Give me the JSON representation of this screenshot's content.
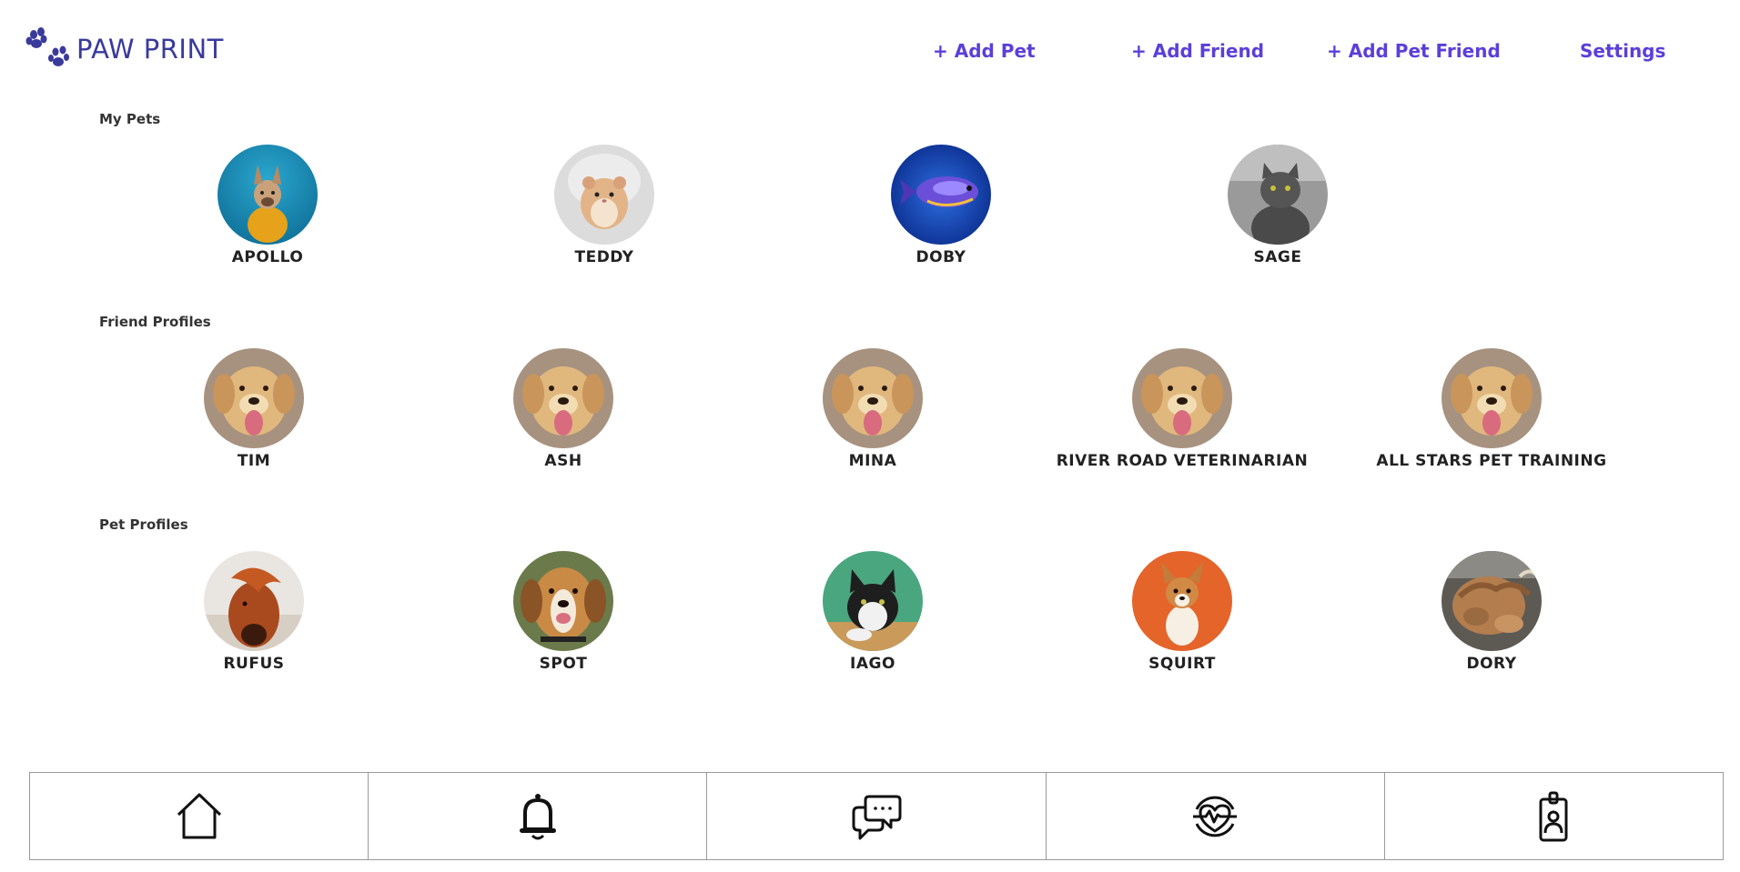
{
  "app": {
    "title": "PAW PRINT",
    "logo_icon": "paw-print-icon",
    "brand_color": "#3a3a9c",
    "accent_color": "#5b3fd9"
  },
  "nav": {
    "add_pet": "+ Add Pet",
    "add_friend": "+ Add Friend",
    "add_pet_friend": "+ Add Pet Friend",
    "settings": "Settings"
  },
  "sections": {
    "my_pets": {
      "title": "My Pets",
      "items": [
        {
          "name": "APOLLO",
          "photo": "french-bulldog-photo"
        },
        {
          "name": "TEDDY",
          "photo": "hamster-photo"
        },
        {
          "name": "DOBY",
          "photo": "fish-photo"
        },
        {
          "name": "SAGE",
          "photo": "gray-cat-photo"
        }
      ]
    },
    "friend_profiles": {
      "title": "Friend Profiles",
      "items": [
        {
          "name": "TIM",
          "photo": "golden-retriever-photo"
        },
        {
          "name": "ASH",
          "photo": "golden-retriever-photo"
        },
        {
          "name": "MINA",
          "photo": "golden-retriever-photo"
        },
        {
          "name": "RIVER ROAD VETERINARIAN",
          "photo": "golden-retriever-photo"
        },
        {
          "name": "ALL STARS PET TRAINING",
          "photo": "golden-retriever-photo"
        }
      ]
    },
    "pet_profiles": {
      "title": "Pet Profiles",
      "items": [
        {
          "name": "RUFUS",
          "photo": "pony-photo"
        },
        {
          "name": "SPOT",
          "photo": "beagle-photo"
        },
        {
          "name": "IAGO",
          "photo": "tuxedo-cat-photo"
        },
        {
          "name": "SQUIRT",
          "photo": "corgi-photo"
        },
        {
          "name": "DORY",
          "photo": "highland-cow-photo"
        }
      ]
    }
  },
  "tabbar": [
    {
      "icon": "home-icon"
    },
    {
      "icon": "bell-icon"
    },
    {
      "icon": "chat-icon"
    },
    {
      "icon": "health-heart-icon"
    },
    {
      "icon": "id-badge-icon"
    }
  ]
}
